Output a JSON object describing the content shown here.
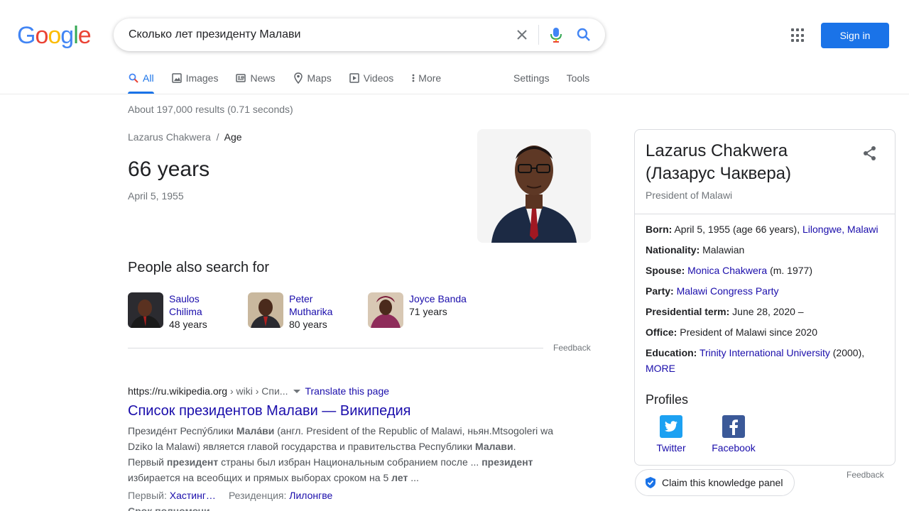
{
  "header": {
    "logo_letters": [
      "G",
      "o",
      "o",
      "g",
      "l",
      "e"
    ],
    "query": "Сколько лет президенту Малави",
    "signin_label": "Sign in"
  },
  "tabs": [
    {
      "label": "All",
      "icon": "search-icon",
      "active": true
    },
    {
      "label": "Images",
      "icon": "image-icon"
    },
    {
      "label": "News",
      "icon": "news-icon"
    },
    {
      "label": "Maps",
      "icon": "map-pin-icon"
    },
    {
      "label": "Videos",
      "icon": "video-icon"
    },
    {
      "label": "More",
      "icon": "more-vert-icon"
    }
  ],
  "tabs_right": {
    "settings": "Settings",
    "tools": "Tools"
  },
  "stats": "About 197,000 results (0.71 seconds)",
  "answer": {
    "entity": "Lazarus Chakwera",
    "separator": "/",
    "attribute": "Age",
    "value": "66 years",
    "sub": "April 5, 1955"
  },
  "people_also_search": {
    "title": "People also search for",
    "items": [
      {
        "name": "Saulos Chilima",
        "age": "48 years"
      },
      {
        "name": "Peter Mutharika",
        "age": "80 years"
      },
      {
        "name": "Joyce Banda",
        "age": "71 years"
      }
    ],
    "feedback": "Feedback"
  },
  "result": {
    "url_host": "https://ru.wikipedia.org",
    "url_path": " › wiki › Спи...",
    "translate": "Translate this page",
    "title": "Список президентов Малави — Википедия",
    "snippet_l1_a": "Президе́нт Респу́блики ",
    "snippet_l1_b": "Мала́ви",
    "snippet_l1_c": " (англ. President of the Republic of Malawi, ньян.Mtsogoleri wa Dziko la Malawi) является главой государства и правительства Республики ",
    "snippet_l1_d": "Малави",
    "snippet_l1_e": ".",
    "snippet_l2_a": "Первый ",
    "snippet_l2_b": "президент",
    "snippet_l2_c": " страны был избран Национальным собранием после ... ",
    "snippet_l2_d": "президент",
    "snippet_l2_e": " избирается на всеобщих и прямых выборах сроком на 5 ",
    "snippet_l2_f": "лет",
    "snippet_l2_g": " ...",
    "meta1_label": "Первый: ",
    "meta1_value": "Хастинг…",
    "meta2_label": "Резиденция: ",
    "meta2_value": "Лилонгве",
    "meta3_label": "Срок полномочи"
  },
  "knowledge_panel": {
    "title": "Lazarus Chakwera (Лазарус Чаквера)",
    "subtitle": "President of Malawi",
    "facts": {
      "born_label": "Born:",
      "born_value": " April 5, 1955 (age 66 years), ",
      "born_link": "Lilongwe, Malawi",
      "nationality_label": "Nationality:",
      "nationality_value": " Malawian",
      "spouse_label": "Spouse:",
      "spouse_link": "Monica Chakwera",
      "spouse_value": " (m. 1977)",
      "party_label": "Party:",
      "party_link": "Malawi Congress Party",
      "term_label": "Presidential term:",
      "term_value": " June 28, 2020 –",
      "office_label": "Office:",
      "office_value": " President of Malawi since 2020",
      "education_label": "Education:",
      "education_link": "Trinity International University",
      "education_value": " (2000),",
      "more_link": "MORE"
    },
    "profiles_title": "Profiles",
    "profiles": [
      {
        "label": "Twitter",
        "icon": "twitter-icon",
        "color": "#1da1f2"
      },
      {
        "label": "Facebook",
        "icon": "facebook-icon",
        "color": "#3b5998"
      }
    ],
    "feedback": "Feedback",
    "claim": "Claim this knowledge panel"
  },
  "colors": {
    "link": "#1a0dab",
    "accent": "#1a73e8",
    "muted": "#70757a"
  }
}
